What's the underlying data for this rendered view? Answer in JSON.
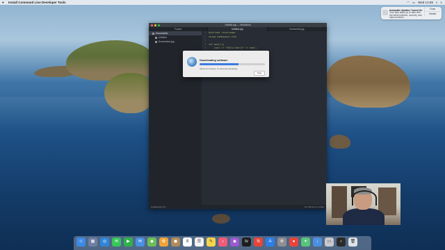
{
  "menubar": {
    "app_name": "Install Command Line Developer Tools",
    "clock": "Wed 14:59"
  },
  "notification": {
    "title": "Automatic Updates Turned On",
    "body": "Your Mac stays up to date with the latest features, security, and improvements.",
    "button_close": "Close",
    "button_details": "Details"
  },
  "editor": {
    "window_title": "Untitled.cpp — HelloWorld",
    "tabs": [
      "Project",
      "Untitled.cpp",
      "Screenshot.jpg"
    ],
    "tree": {
      "root": "Documents",
      "items": [
        "Untitled",
        "Screenshot.jpg"
      ]
    },
    "code_lines": [
      {
        "num": "1",
        "text": "#include <iostream>"
      },
      {
        "num": "2",
        "text": "using namespace std;"
      },
      {
        "num": "3",
        "text": ""
      },
      {
        "num": "4",
        "text": "int main(){"
      },
      {
        "num": "5",
        "text": "    cout << \"Hello World\" << endl;"
      }
    ],
    "status_left": "Untitled.cpp  3:6",
    "status_right": "LF  UTF-8  C++  0 files"
  },
  "dialog": {
    "title": "Downloading software",
    "status": "About 11 minutes, 17 seconds remaining",
    "stop_label": "Stop",
    "progress": 0.6
  },
  "dock": {
    "icons": [
      {
        "name": "finder-icon",
        "color": "#3d8ae6",
        "glyph": "☺"
      },
      {
        "name": "launchpad-icon",
        "color": "#6f7ea3",
        "glyph": "▦"
      },
      {
        "name": "safari-icon",
        "color": "#2f86d9",
        "glyph": "◎"
      },
      {
        "name": "messages-icon",
        "color": "#35c759",
        "glyph": "✉"
      },
      {
        "name": "facetime-icon",
        "color": "#2fb14c",
        "glyph": "▶"
      },
      {
        "name": "mail-icon",
        "color": "#4a90e2",
        "glyph": "✉"
      },
      {
        "name": "maps-icon",
        "color": "#6bbf59",
        "glyph": "◆"
      },
      {
        "name": "photos-icon",
        "color": "#f0a33a",
        "glyph": "✿"
      },
      {
        "name": "contacts-icon",
        "color": "#b08a5a",
        "glyph": "◼"
      },
      {
        "name": "calendar-icon",
        "color": "#ffffff",
        "glyph": "8"
      },
      {
        "name": "reminders-icon",
        "color": "#f2f2f2",
        "glyph": "☰"
      },
      {
        "name": "notes-icon",
        "color": "#f6d34a",
        "glyph": "✎"
      },
      {
        "name": "music-icon",
        "color": "#f05b78",
        "glyph": "♪"
      },
      {
        "name": "podcasts-icon",
        "color": "#9b59d0",
        "glyph": "◉"
      },
      {
        "name": "tv-icon",
        "color": "#1d1d1f",
        "glyph": "tv"
      },
      {
        "name": "news-icon",
        "color": "#e5463a",
        "glyph": "N"
      },
      {
        "name": "appstore-icon",
        "color": "#2d7ee9",
        "glyph": "A"
      },
      {
        "name": "settings-icon",
        "color": "#8e8e93",
        "glyph": "⚙"
      },
      {
        "name": "chrome-icon",
        "color": "#e8453c",
        "glyph": "●"
      },
      {
        "name": "atom-icon",
        "color": "#57c57a",
        "glyph": "✦"
      },
      {
        "name": "downloads-icon",
        "color": "#4c8fe0",
        "glyph": "↓"
      },
      {
        "name": "finder-window-icon",
        "color": "#c7c7cc",
        "glyph": "▭"
      },
      {
        "name": "terminal-icon",
        "color": "#2b2b2b",
        "glyph": "›"
      },
      {
        "name": "trash-icon",
        "color": "#dfe3e8",
        "glyph": "🗑"
      }
    ]
  }
}
